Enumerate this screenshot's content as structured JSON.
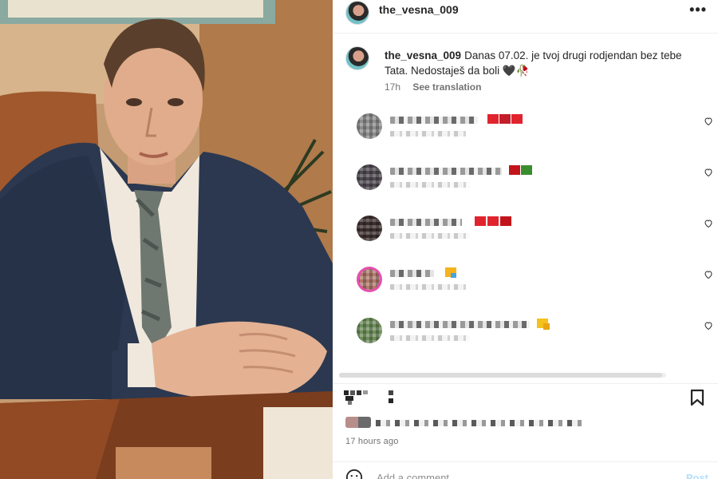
{
  "post": {
    "username": "the_vesna_009",
    "caption_text": "Danas 07.02. je tvoj drugi rodjendan bez tebe Tata. Nedostaješ da boli 🖤🥀",
    "caption_age": "17h",
    "see_translation": "See translation",
    "timestamp": "17 hours ago"
  },
  "header": {
    "more_icon": "more-horizontal-icon"
  },
  "comments": [
    {
      "emoji_colors": [
        "#e0242e",
        "#c21f2b",
        "#e0242e"
      ]
    },
    {
      "emoji_colors": [
        "#c2151b",
        "#3a8d2f"
      ]
    },
    {
      "emoji_colors": [
        "#e0242e",
        "#e0242e",
        "#c2151b"
      ]
    },
    {
      "emoji_colors": [
        "#f5b31c",
        "#4aa3df"
      ]
    },
    {
      "emoji_colors": [
        "#f5c11c",
        "#e8a512"
      ]
    }
  ],
  "actions": {
    "icons": [
      "heart-icon",
      "comment-icon",
      "bookmark-icon"
    ]
  },
  "comment_box": {
    "placeholder": "Add a comment...",
    "post_label": "Post",
    "emoji_icon": "smiley-icon"
  },
  "colors": {
    "accent": "#0095f6",
    "post_disabled": "#b2dffc",
    "secondary_text": "#737373"
  }
}
